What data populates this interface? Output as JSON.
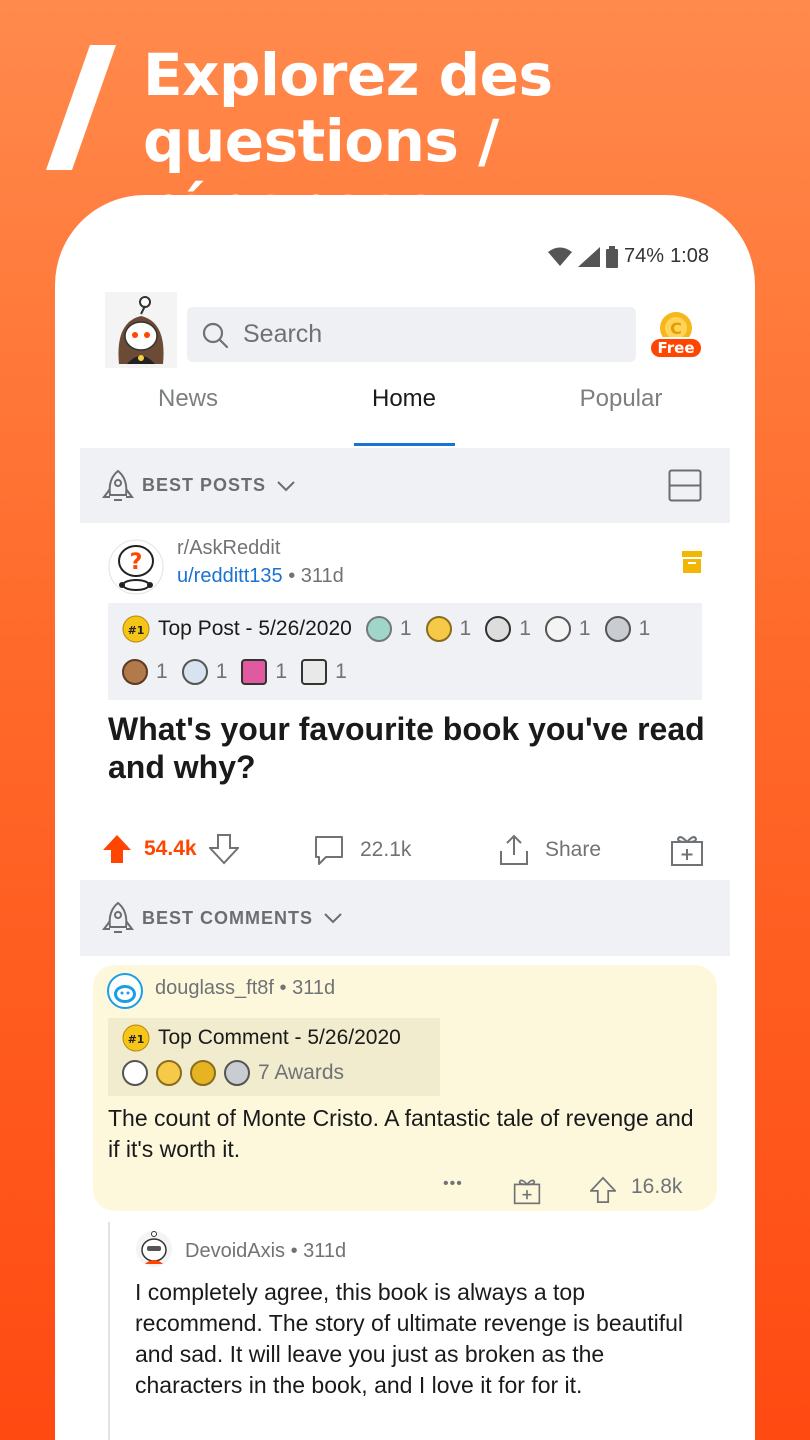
{
  "banner": {
    "headline_line1": "Explorez des",
    "headline_line2": "questions / réponses"
  },
  "status_bar": {
    "battery": "74%",
    "time": "1:08"
  },
  "topbar": {
    "search_placeholder": "Search",
    "coin_label": "Free"
  },
  "tabs": [
    {
      "label": "News"
    },
    {
      "label": "Home"
    },
    {
      "label": "Popular"
    }
  ],
  "best_posts_label": "BEST POSTS",
  "post": {
    "subreddit": "r/AskReddit",
    "author": "u/redditt135",
    "age": "• 311d",
    "top_post_badge": "#1",
    "top_post_label": "Top Post - 5/26/2020",
    "award_counts": [
      "1",
      "1",
      "1",
      "1",
      "1",
      "1",
      "1",
      "1",
      "1"
    ],
    "title": "What's your favourite book you've read and why?",
    "upvotes": "54.4k",
    "comments": "22.1k",
    "share_label": "Share"
  },
  "best_comments_label": "BEST COMMENTS",
  "comment": {
    "author": "douglass_ft8f",
    "age": "• 311d",
    "top_comment_label": "Top Comment - 5/26/2020",
    "awards_count": "7 Awards",
    "body": "The count of Monte Cristo. A fantastic tale of revenge and if it's worth it.",
    "more_label": "•••",
    "upvotes": "16.8k"
  },
  "reply": {
    "author": "DevoidAxis",
    "age": "• 311d",
    "body": "I completely agree, this book is always a top recommend.  The story of ultimate revenge is beautiful and sad. It will leave you just as broken as the characters in the book, and I love it for for it."
  },
  "colors": {
    "accent_orange": "#ff4500",
    "link_blue": "#1a72d3",
    "comment_highlight": "#fdf8dc"
  }
}
